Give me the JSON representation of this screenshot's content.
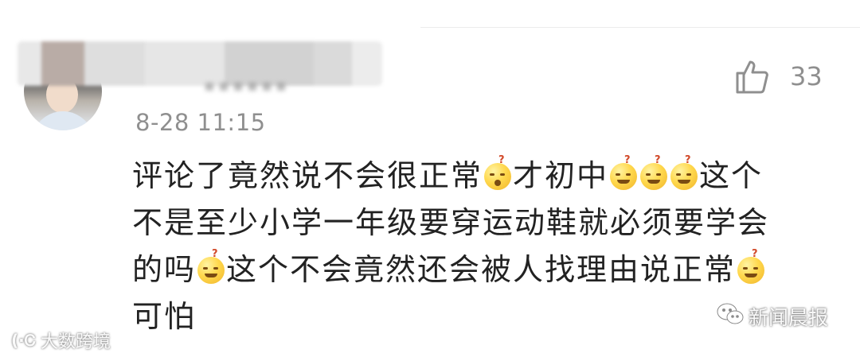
{
  "comment": {
    "timestamp": "8-28 11:15",
    "like_count": "33",
    "lines": [
      [
        {
          "t": "text",
          "v": "评论了竟然说不会很正常"
        },
        {
          "t": "emoji",
          "icon": "puzzled-face-emoji",
          "v": "?"
        },
        {
          "t": "text",
          "v": "才初中"
        },
        {
          "t": "emoji",
          "icon": "grinning-sweat-emoji",
          "v": "?"
        },
        {
          "t": "emoji",
          "icon": "grinning-sweat-emoji",
          "v": "?"
        },
        {
          "t": "emoji",
          "icon": "grinning-sweat-emoji",
          "v": "?"
        },
        {
          "t": "text",
          "v": "这个"
        }
      ],
      [
        {
          "t": "text",
          "v": "不是至少小学一年级要穿运动鞋就必须要学会"
        }
      ],
      [
        {
          "t": "text",
          "v": "的吗"
        },
        {
          "t": "emoji",
          "icon": "grinning-sweat-emoji",
          "v": "?"
        },
        {
          "t": "text",
          "v": "这个不会竟然还会被人找理由说正常"
        },
        {
          "t": "emoji",
          "icon": "grinning-sweat-emoji",
          "v": "?"
        }
      ],
      [
        {
          "t": "text",
          "v": "可怕"
        }
      ]
    ]
  },
  "icons": {
    "like": "thumbs-up-icon",
    "avatar": "user-avatar"
  },
  "watermarks": {
    "left_text": "大数跨境",
    "right_text": "新闻晨报"
  },
  "colors": {
    "meta_gray": "#8f8f8f",
    "text": "#222222",
    "emoji_yellow": "#ffd84d"
  }
}
